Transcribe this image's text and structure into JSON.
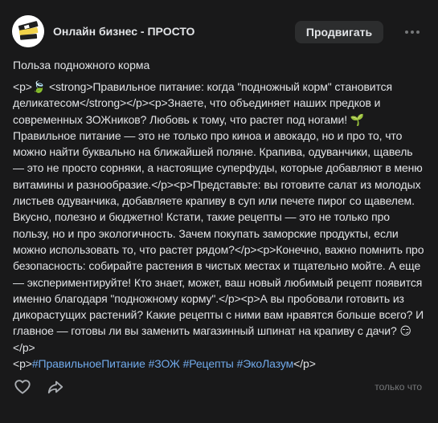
{
  "header": {
    "group_name": "Онлайн бизнес - ПРОСТО",
    "promote_label": "Продвигать",
    "more_icon": "more-horizontal-icon"
  },
  "post": {
    "title": "Польза подножного корма",
    "body_main": "<p>🍃 <strong>Правильное питание: когда \"подножный корм\" становится деликатесом</strong></p><p>Знаете, что объединяет наших предков и современных ЗОЖников? Любовь к тому, что растет под ногами! 🌱 Правильное питание — это не только про киноа и авокадо, но и про то, что можно найти буквально на ближайшей поляне. Крапива, одуванчики, щавель — это не просто сорняки, а настоящие суперфуды, которые добавляют в меню витамины и разнообразие.</p><p>Представьте: вы готовите салат из молодых листьев одуванчика, добавляете крапиву в суп или печете пирог со щавелем. Вкусно, полезно и бюджетно! Кстати, такие рецепты — это не только про пользу, но и про экологичность. Зачем покупать заморские продукты, если можно использовать то, что растет рядом?</p><p>Конечно, важно помнить про безопасность: собирайте растения в чистых местах и тщательно мойте. А еще — экспериментируйте! Кто знает, может, ваш новый любимый рецепт появится именно благодаря \"подножному корму\".</p><p>А вы пробовали готовить из дикорастущих растений? Какие рецепты с ними вам нравятся больше всего? И главное — готовы ли вы заменить магазинный шпинат на крапиву с дачи? 😏</p>",
    "hashtag_prefix": "<p>",
    "hashtags": [
      "#ПравильноеПитание",
      "#ЗОЖ",
      "#Рецепты",
      "#ЭкоЛазум"
    ],
    "hashtag_suffix": "</p>"
  },
  "footer": {
    "like_icon": "heart-icon",
    "share_icon": "share-arrow-icon",
    "time": "только что"
  },
  "colors": {
    "background": "#19191a",
    "text": "#e1e3e6",
    "link": "#71aaeb",
    "secondary": "#76787a",
    "button": "#2c2d2e"
  }
}
